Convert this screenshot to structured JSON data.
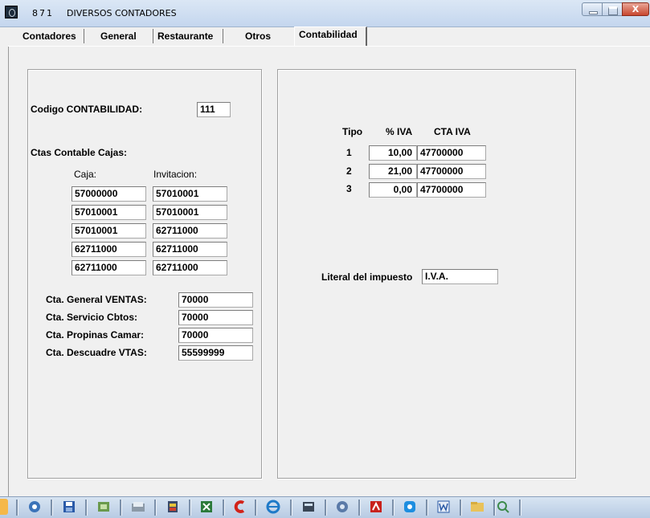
{
  "window": {
    "code": "871",
    "title": "DIVERSOS CONTADORES",
    "close_glyph": "X"
  },
  "tabs": [
    "Contadores",
    "General",
    "Restaurante",
    "Otros",
    "Contabilidad"
  ],
  "active_tab": "Contabilidad",
  "left": {
    "codigo_label": "Codigo CONTABILIDAD:",
    "codigo_value": "111",
    "ctas_label": "Ctas Contable Cajas:",
    "col_caja": "Caja:",
    "col_invitacion": "Invitacion:",
    "rows": [
      {
        "caja": "57000000",
        "invitacion": "57010001"
      },
      {
        "caja": "57010001",
        "invitacion": "57010001"
      },
      {
        "caja": "57010001",
        "invitacion": "62711000"
      },
      {
        "caja": "62711000",
        "invitacion": "62711000"
      },
      {
        "caja": "62711000",
        "invitacion": "62711000"
      }
    ],
    "cuentas": [
      {
        "label": "Cta. General VENTAS:",
        "value": "70000"
      },
      {
        "label": "Cta. Servicio Cbtos:",
        "value": "70000"
      },
      {
        "label": "Cta. Propinas Camar:",
        "value": "70000"
      },
      {
        "label": "Cta. Descuadre VTAS:",
        "value": "55599999"
      }
    ]
  },
  "right": {
    "headers": {
      "tipo": "Tipo",
      "iva": "% IVA",
      "cta": "CTA IVA"
    },
    "iva_rows": [
      {
        "tipo": "1",
        "iva": "10,00",
        "cta": "47700000"
      },
      {
        "tipo": "2",
        "iva": "21,00",
        "cta": "47700000"
      },
      {
        "tipo": "3",
        "iva": "0,00",
        "cta": "47700000"
      }
    ],
    "literal_label": "Literal del impuesto",
    "literal_value": "I.V.A."
  },
  "taskbar": {
    "icons": [
      "chrome-icon",
      "save-icon",
      "cd-icon",
      "folder-icon",
      "tools-icon",
      "excel-icon",
      "c-icon",
      "ie-icon",
      "calculator-icon",
      "globe-icon",
      "pdf-icon",
      "skype-icon",
      "word-icon",
      "explorer-icon",
      "search-icon"
    ]
  }
}
